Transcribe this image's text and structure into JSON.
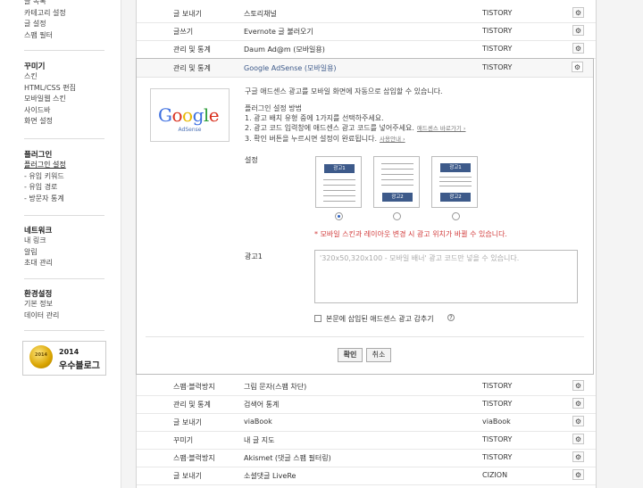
{
  "sidebar": {
    "top_items": [
      "글 목록",
      "카테고리 설정",
      "글 설정",
      "스팸 필터"
    ],
    "decor": {
      "title": "꾸미기",
      "items": [
        "스킨",
        "HTML/CSS 편집",
        "모바일웹 스킨",
        "사이드바",
        "화면 설정"
      ]
    },
    "plugin": {
      "title": "플러그인",
      "items": [
        "플러그인 설정",
        "- 유입 키워드",
        "- 유입 경로",
        "- 방문자 통계"
      ]
    },
    "network": {
      "title": "네트워크",
      "items": [
        "내 링크",
        "알림",
        "초대 관리"
      ]
    },
    "env": {
      "title": "환경설정",
      "items": [
        "기본 정보",
        "데이터 관리"
      ]
    },
    "badge": {
      "medal_text": "2014",
      "year": "2014",
      "name": "우수블로그"
    }
  },
  "rows_top": [
    {
      "cat": "글 보내기",
      "name": "스토리채널",
      "maker": "TISTORY"
    },
    {
      "cat": "글쓰기",
      "name": "Evernote 글 불러오기",
      "maker": "TISTORY"
    },
    {
      "cat": "관리 및 통계",
      "name": "Daum Ad@m (모바일용)",
      "maker": "TISTORY"
    }
  ],
  "panel": {
    "cat": "관리 및 통계",
    "name": "Google AdSense (모바일용)",
    "maker": "TISTORY",
    "logo_sub": "AdSense",
    "desc": "구글 애드센스 광고를 모바일 화면에 자동으로 삽입할 수 있습니다.",
    "method_title": "플러그인 설정 방법",
    "step1": "1. 광고 배치 유형 중에 1가지를 선택하주세요.",
    "step2": "2. 광고 코드 입력창에 애드센스 광고 코드를 넣어주세요.",
    "step2_link": "애드센스 바로가기 ›",
    "step3": "3. 확인 버튼을 누르시면 설정이 완료됩니다.",
    "step3_link": "사용안내 ›",
    "setting_label": "설정",
    "ad1_label": "광고1",
    "ad2_label": "광고2",
    "warning": "* 모바일 스킨과 레이아웃 변경 시 광고 위치가 바뀔 수 있습니다.",
    "ad_field_label": "광고1",
    "ad_placeholder": "'320x50,320x100 - 모바일 배너' 광고 코드만 넣을 수 있습니다.",
    "hide_label": "본문에 삽입된 애드센스 광고 감추기",
    "help_glyph": "?",
    "ok": "확인",
    "cancel": "취소"
  },
  "rows_bottom": [
    {
      "cat": "스팸·블럭방지",
      "name": "그림 문자(스팸 차단)",
      "maker": "TISTORY"
    },
    {
      "cat": "관리 및 통계",
      "name": "검색어 통계",
      "maker": "TISTORY"
    },
    {
      "cat": "글 보내기",
      "name": "viaBook",
      "maker": "viaBook"
    },
    {
      "cat": "꾸미기",
      "name": "내 글 지도",
      "maker": "TISTORY"
    },
    {
      "cat": "스팸·블럭방지",
      "name": "Akismet (댓글 스팸 필터링)",
      "maker": "TISTORY"
    },
    {
      "cat": "글 보내기",
      "name": "소셜댓글 LiveRe",
      "maker": "CIZION"
    }
  ],
  "gear_glyph": "⚙",
  "colors": {
    "google_blue": "#3d6fe0",
    "google_red": "#d9301e",
    "google_yellow": "#e8b800",
    "google_green": "#2e9e3a",
    "warning": "#d23b3b"
  }
}
